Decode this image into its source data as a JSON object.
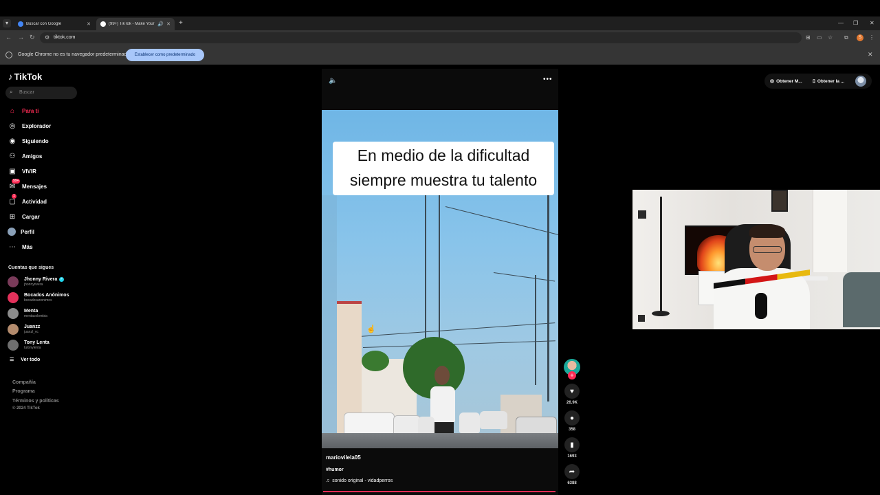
{
  "browser": {
    "tabs": [
      {
        "title": "Buscar con Google",
        "favicon_color": "#4285f4"
      },
      {
        "title": "(99+) TikTok - Make Your Day",
        "favicon_color": "#000000"
      }
    ],
    "url": "tiktok.com",
    "infobar": {
      "message": "Google Chrome no es tu navegador predeterminado",
      "button": "Establecer como predeterminado"
    },
    "profile_letter": "S"
  },
  "sidebar": {
    "logo": "TikTok",
    "search_placeholder": "Buscar",
    "nav": [
      {
        "label": "Para ti",
        "icon": "home-icon",
        "active": true
      },
      {
        "label": "Explorador",
        "icon": "compass-icon"
      },
      {
        "label": "Siguiendo",
        "icon": "following-icon"
      },
      {
        "label": "Amigos",
        "icon": "friends-icon"
      },
      {
        "label": "VIVIR",
        "icon": "live-icon"
      },
      {
        "label": "Mensajes",
        "icon": "messages-icon",
        "badge": "99+"
      },
      {
        "label": "Actividad",
        "icon": "activity-icon",
        "badge": "1"
      },
      {
        "label": "Cargar",
        "icon": "upload-icon"
      },
      {
        "label": "Perfil",
        "icon": "profile-icon"
      },
      {
        "label": "Más",
        "icon": "more-icon"
      }
    ],
    "following_title": "Cuentas que sigues",
    "following": [
      {
        "name": "Jhonny Rivera",
        "handle": "jhonnyrivera",
        "verified": true,
        "avatar_color": "#7a3b5a"
      },
      {
        "name": "Bocados Anónimos",
        "handle": "bocadosanonimos",
        "verified": false,
        "avatar_color": "#e3315b"
      },
      {
        "name": "Menta",
        "handle": "mentacolombia",
        "verified": false,
        "avatar_color": "#8c8c8c"
      },
      {
        "name": "Juanzz",
        "handle": "juanzl_vc",
        "verified": false,
        "avatar_color": "#b38b6d"
      },
      {
        "name": "Tony Lenta",
        "handle": "tutonylenta",
        "verified": false,
        "avatar_color": "#6f6f6f"
      }
    ],
    "see_all": "Ver todo",
    "footer": [
      "Compañía",
      "Programa",
      "Términos y políticas"
    ],
    "copyright": "© 2024 TikTok"
  },
  "video": {
    "caption_line1": "En medio de la dificultad",
    "caption_line2": "siempre muestra tu talento",
    "username": "mariovilela05",
    "hashtag": "#humor",
    "sound": "sonido original - vidadperros",
    "progress": 1.0
  },
  "actions": {
    "likes": "26.9K",
    "comments": "358",
    "saves": "1693",
    "shares": "6388"
  },
  "top_right": {
    "item1": "Obtener M...",
    "item2": "Obtener la ..."
  },
  "colors": {
    "accent": "#fe2c55",
    "infobar_button": "#a8c7fa"
  }
}
